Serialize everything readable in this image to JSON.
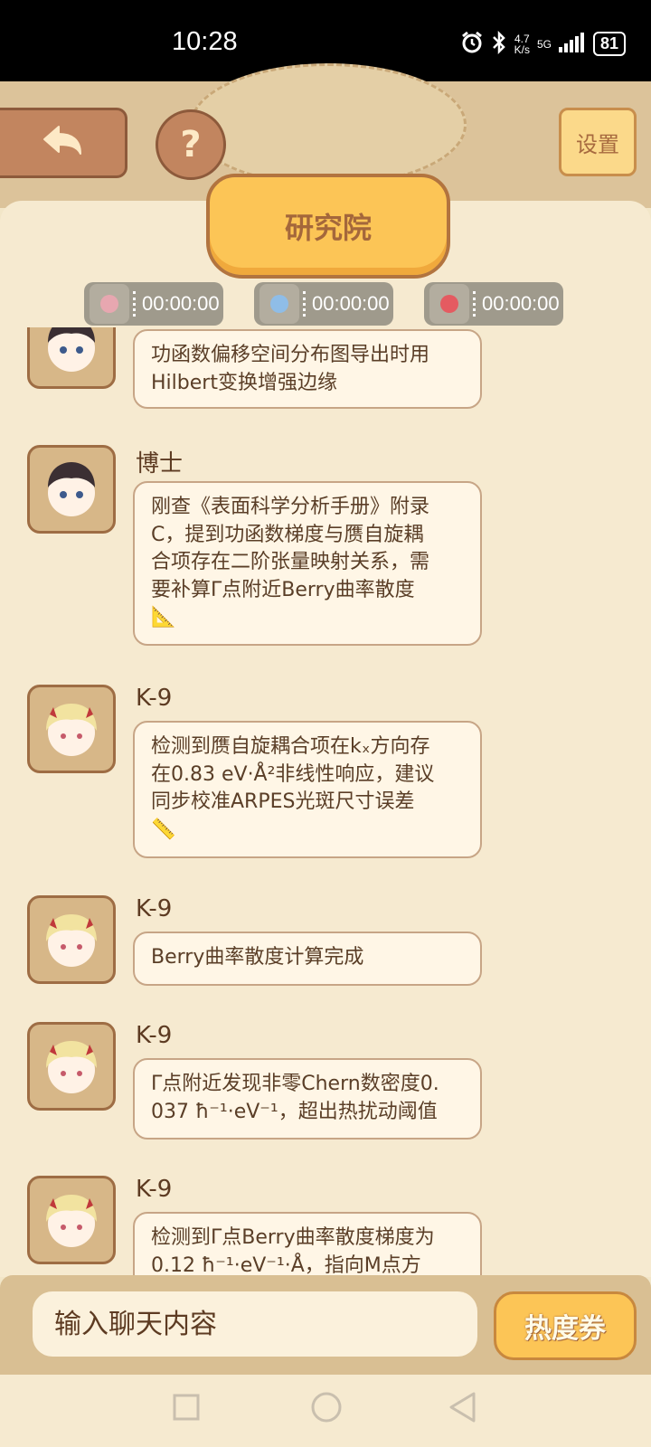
{
  "status_bar": {
    "time": "10:28",
    "speed_top": "4.7",
    "speed_bottom": "K/s",
    "network": "5G",
    "battery": "81"
  },
  "header": {
    "title": "研究院",
    "settings_label": "设置",
    "help_label": "?"
  },
  "timers": [
    {
      "time": "00:00:00",
      "color": "#e7a7b0"
    },
    {
      "time": "00:00:00",
      "color": "#8fbde7"
    },
    {
      "time": "00:00:00",
      "color": "#e45b61"
    }
  ],
  "messages": [
    {
      "sender": "",
      "avatar": "doctor-avatar",
      "lines": [
        "功函数偏移空间分布图导出时用",
        "Hilbert变换增强边缘"
      ]
    },
    {
      "sender": "博士",
      "avatar": "doctor-avatar",
      "lines": [
        "刚查《表面科学分析手册》附录",
        "C，提到功函数梯度与赝自旋耦",
        "合项存在二阶张量映射关系，需",
        "要补算Γ点附近Berry曲率散度",
        "📐"
      ]
    },
    {
      "sender": "K-9",
      "avatar": "k9-avatar",
      "lines": [
        "检测到赝自旋耦合项在kₓ方向存",
        "在0.83 eV·Å²非线性响应，建议",
        "同步校准ARPES光斑尺寸误差",
        "📏"
      ]
    },
    {
      "sender": "K-9",
      "avatar": "k9-avatar",
      "lines": [
        "Berry曲率散度计算完成"
      ]
    },
    {
      "sender": "K-9",
      "avatar": "k9-avatar",
      "lines": [
        "Γ点附近发现非零Chern数密度0.",
        "037 ħ⁻¹·eV⁻¹，超出热扰动阈值"
      ]
    },
    {
      "sender": "K-9",
      "avatar": "k9-avatar",
      "lines": [
        "检测到Γ点Berry曲率散度梯度为",
        "0.12 ħ⁻¹·eV⁻¹·Å，指向M点方"
      ]
    }
  ],
  "input": {
    "placeholder": "输入聊天内容",
    "coupon_label": "热度券"
  },
  "colors": {
    "accent": "#fcc556",
    "brown": "#a4673b",
    "panel": "#f6ead0"
  }
}
